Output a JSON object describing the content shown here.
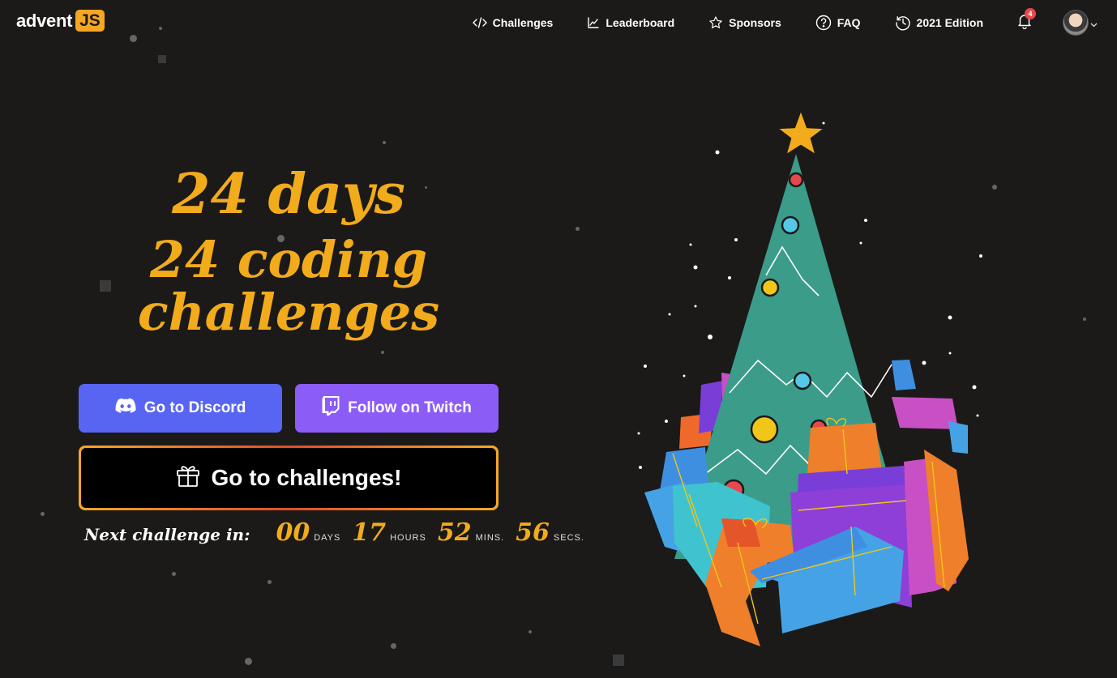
{
  "logo": {
    "text": "advent",
    "badge": "JS"
  },
  "nav": {
    "items": [
      {
        "label": "Challenges",
        "icon": "code-icon"
      },
      {
        "label": "Leaderboard",
        "icon": "chart-icon"
      },
      {
        "label": "Sponsors",
        "icon": "star-icon"
      },
      {
        "label": "FAQ",
        "icon": "question-icon"
      },
      {
        "label": "2021 Edition",
        "icon": "history-icon"
      }
    ],
    "notifications": "4"
  },
  "hero": {
    "line1": "24 days",
    "line2": "24 coding challenges"
  },
  "buttons": {
    "discord": "Go to Discord",
    "twitch": "Follow on Twitch",
    "challenges": "Go to challenges!"
  },
  "countdown": {
    "label": "Next challenge in:",
    "days": "00",
    "days_unit": "DAYS",
    "hours": "17",
    "hours_unit": "HOURS",
    "mins": "52",
    "mins_unit": "MINS.",
    "secs": "56",
    "secs_unit": "SECS."
  },
  "colors": {
    "background": "#1b1a19",
    "accent": "#f2ab1b",
    "discord": "#5865f2",
    "twitch": "#8c5cf6",
    "tree": "#3a9c89"
  }
}
